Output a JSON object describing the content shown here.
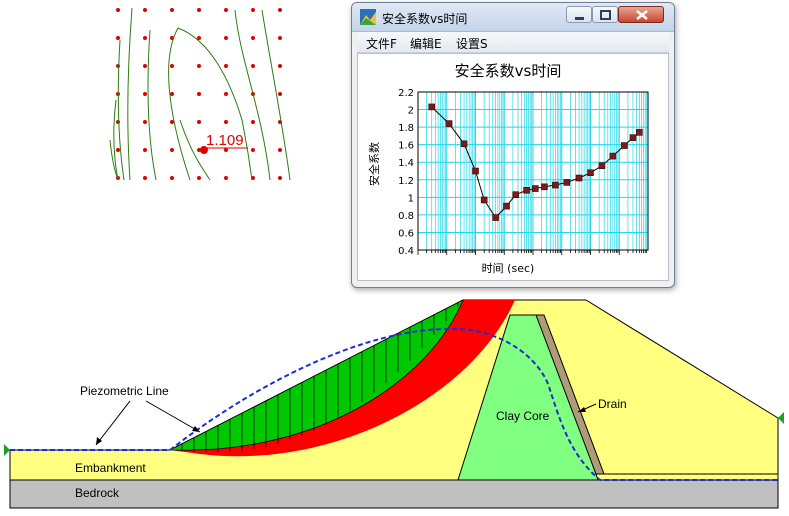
{
  "window": {
    "title": "安全系数vs时间",
    "menu": [
      "文件F",
      "编辑E",
      "设置S"
    ]
  },
  "contour": {
    "min_fs_label": "1.109"
  },
  "dam": {
    "labels": {
      "piezometric_line": "Piezometric Line",
      "embankment": "Embankment",
      "bedrock": "Bedrock",
      "clay_core": "Clay Core",
      "drain": "Drain"
    },
    "colors": {
      "embankment": "#ffff80",
      "clay_core": "#80ff80",
      "drain": "#b09a7a",
      "bedrock": "#c0c0c0",
      "slip_slices": "#00c800",
      "slip_zone": "#ff0000",
      "piezometric": "#1a2fd0"
    }
  },
  "chart_data": {
    "type": "line",
    "title": "安全系数vs时间",
    "xlabel": "时间 (sec)",
    "ylabel": "安全系数",
    "x_scale": "log",
    "xlim": [
      1,
      100000000
    ],
    "ylim": [
      0.4,
      2.2
    ],
    "yticks": [
      "0.4",
      "0.6",
      "0.8",
      "1",
      "1.2",
      "1.4",
      "1.6",
      "1.8",
      "2",
      "2.2"
    ],
    "grid": true,
    "series": [
      {
        "marker": "square",
        "color": "#7a1a1a",
        "x": [
          3,
          12,
          40,
          100,
          200,
          500,
          1200,
          2500,
          6000,
          12000,
          25000,
          60000,
          150000,
          400000,
          1000000,
          2500000,
          6000000,
          15000000,
          30000000,
          50000000
        ],
        "y": [
          2.03,
          1.84,
          1.61,
          1.3,
          0.97,
          0.77,
          0.9,
          1.03,
          1.08,
          1.1,
          1.12,
          1.14,
          1.17,
          1.22,
          1.28,
          1.36,
          1.47,
          1.59,
          1.68,
          1.74
        ]
      }
    ]
  }
}
